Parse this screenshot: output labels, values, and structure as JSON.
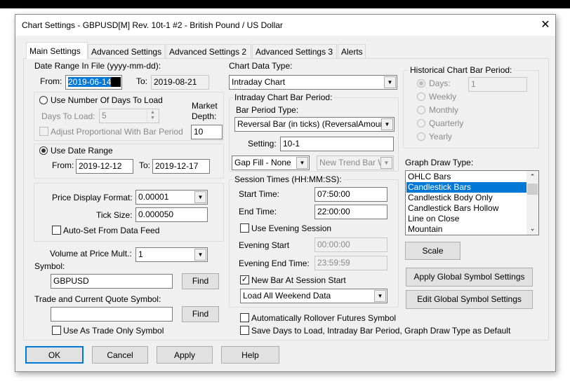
{
  "window": {
    "title": "Chart Settings - GBPUSD[M]  Rev. 10t-1  #2 - British Pound / US Dollar",
    "close_icon": "close-icon"
  },
  "tabs": [
    {
      "label": "Main Settings",
      "selected": true
    },
    {
      "label": "Advanced Settings"
    },
    {
      "label": "Advanced Settings 2"
    },
    {
      "label": "Advanced Settings 3"
    },
    {
      "label": "Alerts"
    }
  ],
  "date_range": {
    "label": "Date Range In File (yyyy-mm-dd):",
    "from_label": "From:",
    "from_value": "2019-06-14",
    "to_label": "To:",
    "to_value": "2019-08-21"
  },
  "days_group": {
    "radio_label": "Use Number Of Days To Load",
    "days_label": "Days To Load:",
    "days_value": "5",
    "market_depth_label1": "Market",
    "market_depth_label2": "Depth:",
    "market_depth_value": "10",
    "adjust_label": "Adjust Proportional With Bar Period"
  },
  "date_group": {
    "radio_label": "Use Date Range",
    "from_label": "From:",
    "from_value": "2019-12-12",
    "to_label": "To:",
    "to_value": "2019-12-17"
  },
  "price_group": {
    "format_label": "Price Display Format:",
    "format_value": "0.00001",
    "tick_label": "Tick Size:",
    "tick_value": "0.000050",
    "autoset_label": "Auto-Set From Data Feed"
  },
  "volume": {
    "label": "Volume at Price Mult.:",
    "value": "1"
  },
  "symbol": {
    "label": "Symbol:",
    "value": "GBPUSD",
    "find": "Find"
  },
  "trade_symbol": {
    "label": "Trade and Current Quote Symbol:",
    "value": "",
    "find": "Find",
    "trade_only_label": "Use As Trade Only Symbol"
  },
  "chart_data_type": {
    "label": "Chart Data Type:",
    "value": "Intraday Chart"
  },
  "intraday": {
    "label": "Intraday Chart Bar Period:",
    "bar_type_label": "Bar Period Type:",
    "bar_type_value": "Reversal Bar (in ticks) (ReversalAmount",
    "setting_label": "Setting:",
    "setting_value": "10-1",
    "gap_fill": "Gap Fill - None",
    "new_trend": "New Trend Bar W"
  },
  "session": {
    "label": "Session Times (HH:MM:SS):",
    "start_label": "Start Time:",
    "start_value": "07:50:00",
    "end_label": "End Time:",
    "end_value": "22:00:00",
    "evening_label": "Use Evening Session",
    "evening_start_label": "Evening Start",
    "evening_start_value": "00:00:00",
    "evening_end_label": "Evening End Time:",
    "evening_end_value": "23:59:59",
    "new_bar_label": "New Bar At Session Start",
    "weekend_value": "Load All Weekend Data"
  },
  "rollover_label": "Automatically Rollover Futures Symbol",
  "save_default_label": "Save Days to Load, Intraday Bar Period, Graph Draw Type as Default",
  "historical": {
    "label": "Historical Chart Bar Period:",
    "options": [
      "Days:",
      "Weekly",
      "Monthly",
      "Quarterly",
      "Yearly"
    ],
    "selected": "Days:",
    "days_value": "1"
  },
  "graph_draw": {
    "label": "Graph Draw Type:",
    "items": [
      "OHLC Bars",
      "Candlestick Bars",
      "Candlestick Body Only",
      "Candlestick Bars Hollow",
      "Line on Close",
      "Mountain"
    ],
    "selected": "Candlestick Bars"
  },
  "buttons": {
    "scale": "Scale",
    "apply_global": "Apply Global Symbol Settings",
    "edit_global": "Edit Global Symbol Settings",
    "ok": "OK",
    "cancel": "Cancel",
    "apply": "Apply",
    "help": "Help"
  },
  "colors": {
    "selection": "#0078d7",
    "dialog_bg": "#f0f0f0"
  }
}
